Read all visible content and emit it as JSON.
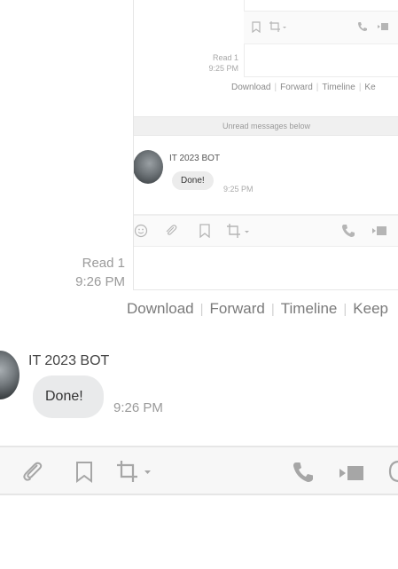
{
  "nested": {
    "read_label": "Read 1",
    "read_time": "9:25 PM",
    "actions": [
      "Download",
      "Forward",
      "Timeline",
      "Ke"
    ],
    "unread_banner": "Unread messages below",
    "sender": "IT 2023 BOT",
    "message": "Done!",
    "message_time": "9:25 PM"
  },
  "read_status": {
    "label": "Read 1",
    "time": "9:26 PM"
  },
  "actions": {
    "download": "Download",
    "forward": "Forward",
    "timeline": "Timeline",
    "keep": "Keep"
  },
  "message": {
    "sender": "IT 2023 BOT",
    "text": "Done!",
    "time": "9:26 PM"
  },
  "toolbar": {
    "icons": [
      "paperclip-icon",
      "bookmark-icon",
      "crop-icon",
      "phone-icon",
      "video-icon",
      "at-icon"
    ]
  },
  "colors": {
    "muted": "#9a9a9a",
    "bubble": "#e9eaeb",
    "toolbar_bg": "#f7f7f7"
  }
}
